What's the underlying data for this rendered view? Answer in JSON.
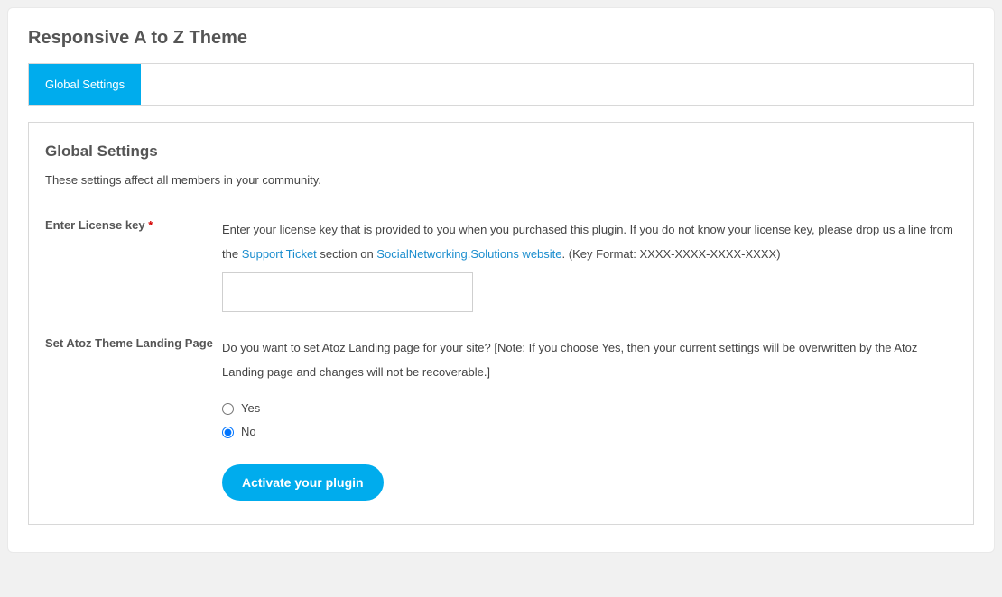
{
  "page": {
    "title": "Responsive A to Z Theme"
  },
  "tabs": {
    "global": "Global Settings"
  },
  "panel": {
    "title": "Global Settings",
    "description": "These settings affect all members in your community."
  },
  "license": {
    "label": "Enter License key",
    "required_mark": "*",
    "help_part1": "Enter your license key that is provided to you when you purchased this plugin. If you do not know your license key, please drop us a line from the ",
    "link1": "Support Ticket",
    "help_part2": " section on ",
    "link2": "SocialNetworking.Solutions website",
    "help_part3": ". (Key Format: XXXX-XXXX-XXXX-XXXX)",
    "value": ""
  },
  "landing": {
    "label": "Set Atoz Theme Landing Page",
    "help": "Do you want to set Atoz Landing page for your site? [Note: If you choose Yes, then your current settings will be overwritten by the Atoz Landing page and changes will not be recoverable.]",
    "option_yes": "Yes",
    "option_no": "No"
  },
  "button": {
    "activate": "Activate your plugin"
  }
}
